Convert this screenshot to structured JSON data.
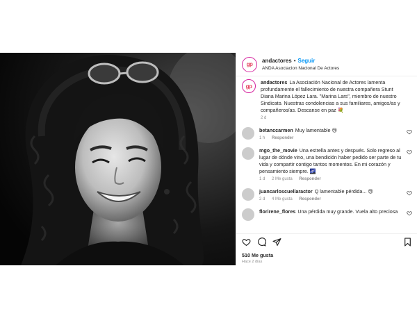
{
  "post_author": {
    "avatar_text": "gp",
    "username": "andactores",
    "separator": "•",
    "follow_label": "Seguir",
    "subtitle": "ANDA Asociacion Nacional De Actores"
  },
  "caption": {
    "username": "andactores",
    "text": "La Asociación Nacional de Actores lamenta profundamente el fallecimiento de nuestra compañera Stunt Diana Marina López Lara. \"Marina Lars\", miembro de nuestro Sindicato. Nuestras condolencias a sus familiares, amigos/as y compañeros/as. Descanse en paz 💐",
    "time": "2 d"
  },
  "comments": [
    {
      "username": "betanccarmen",
      "text": "Muy lamentable 😢",
      "time": "1 h",
      "likes": "",
      "reply_label": "Responder"
    },
    {
      "username": "mgo_the_movie",
      "text": "Una estrella antes y después. Solo regreso al lugar de dónde vino, una bendición haber pedido ser parte de tu vida y compartir contigo tantos momentos. En mi corazón y pensamiento siempre. 🌌",
      "time": "1 d",
      "likes": "2 Me gusta",
      "reply_label": "Responder"
    },
    {
      "username": "juancarloscuellaractor",
      "text": "Q lamentable pérdida... 😢",
      "time": "2 d",
      "likes": "4 Me gusta",
      "reply_label": "Responder"
    },
    {
      "username": "florirene_flores",
      "text": "Una pérdida muy grande. Vuela alto preciosa",
      "time": "",
      "likes": "",
      "reply_label": ""
    }
  ],
  "actions": {
    "icons": [
      "heart-icon",
      "comment-icon",
      "share-icon",
      "bookmark-icon"
    ],
    "likes_count": "510 Me gusta",
    "posted_ago": "Hace 2 días"
  },
  "colors": {
    "accent_blue": "#0095f6",
    "brand_ring": "#d6249f",
    "muted": "#8e8e8e"
  }
}
